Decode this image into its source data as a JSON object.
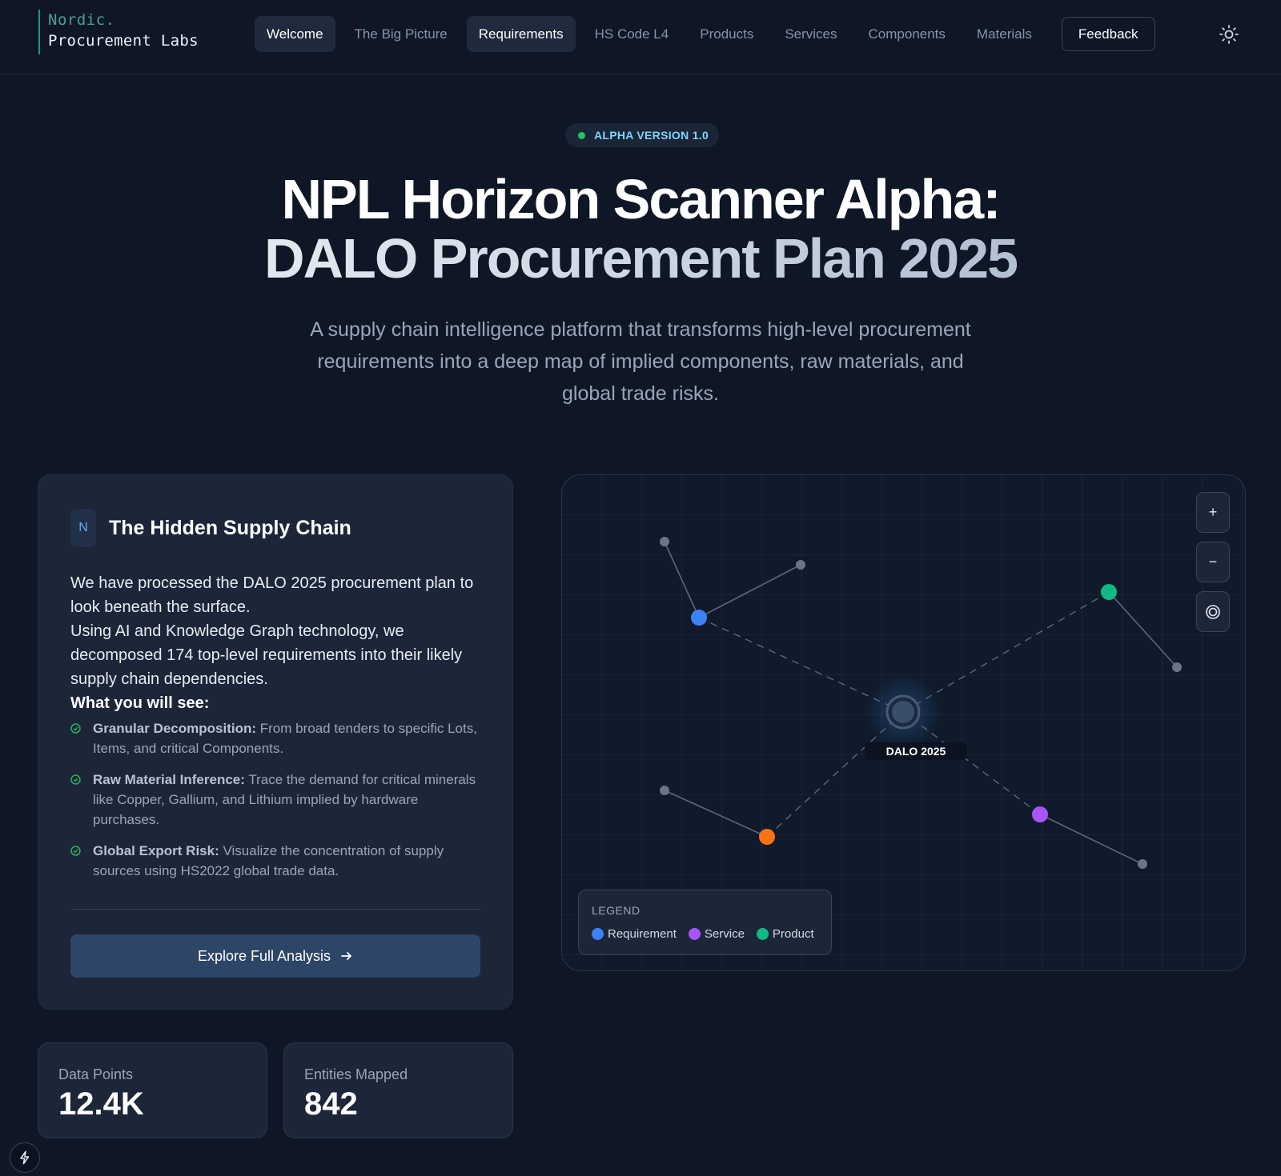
{
  "brand": {
    "line1": "Nordic.",
    "line2": "Procurement Labs"
  },
  "nav": {
    "items": [
      {
        "label": "Welcome"
      },
      {
        "label": "The Big Picture"
      },
      {
        "label": "Requirements"
      },
      {
        "label": "HS Code L4"
      },
      {
        "label": "Products"
      },
      {
        "label": "Services"
      },
      {
        "label": "Components"
      },
      {
        "label": "Materials"
      }
    ],
    "feedback_label": "Feedback",
    "theme_icon": "sun-icon"
  },
  "hero": {
    "badge": "ALPHA VERSION 1.0",
    "title_line1": "NPL Horizon Scanner Alpha:",
    "title_line2": "DALO Procurement Plan 2025",
    "subtitle": "A supply chain intelligence platform that transforms high-level procurement requirements into a deep map of implied components, raw materials, and global trade risks."
  },
  "card": {
    "badge_letter": "N",
    "title": "The Hidden Supply Chain",
    "para1": "We have processed the DALO 2025 procurement plan to look beneath the surface.",
    "para2": "Using AI and Knowledge Graph technology, we decomposed 174 top-level requirements into their likely supply chain dependencies.",
    "see_title": "What you will see:",
    "features": [
      {
        "title": "Granular Decomposition:",
        "text": "From broad tenders to specific Lots, Items, and critical Components."
      },
      {
        "title": "Raw Material Inference:",
        "text": "Trace the demand for critical minerals like Copper, Gallium, and Lithium implied by hardware purchases."
      },
      {
        "title": "Global Export Risk:",
        "text": "Visualize the concentration of supply sources using HS2022 global trade data."
      }
    ],
    "cta_label": "Explore Full Analysis"
  },
  "stats": [
    {
      "label": "Data Points",
      "value": "12.4K"
    },
    {
      "label": "Entities Mapped",
      "value": "842"
    }
  ],
  "graph": {
    "center_label": "DALO 2025",
    "controls": {
      "zoom_in": "+",
      "zoom_out": "−",
      "reset_icon": "target-icon"
    },
    "legend_title": "LEGEND",
    "legend": [
      {
        "label": "Requirement",
        "color": "#3b82f6"
      },
      {
        "label": "Service",
        "color": "#a855f7"
      },
      {
        "label": "Product",
        "color": "#10b981"
      }
    ],
    "colors": {
      "requirement": "#3b82f6",
      "service": "#a855f7",
      "product": "#10b981",
      "other": "#f97316",
      "leaf": "#6b7589"
    }
  }
}
